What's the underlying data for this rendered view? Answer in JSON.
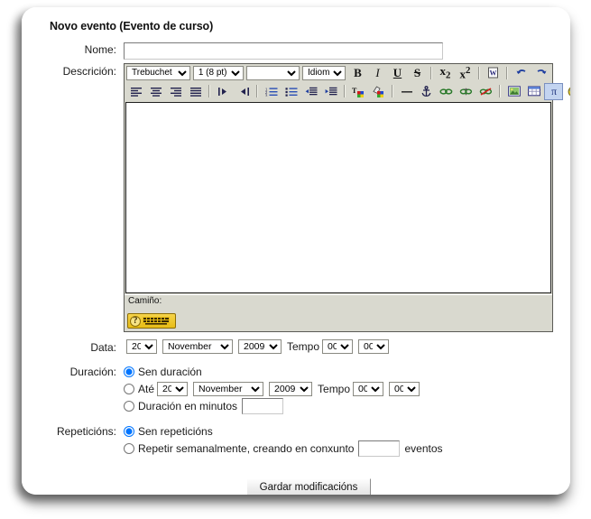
{
  "form": {
    "title": "Novo evento (Evento de curso)",
    "save_label": "Gardar modificacións"
  },
  "fields": {
    "name_label": "Nome:",
    "name_value": "",
    "description_label": "Descrición:",
    "date_label": "Data:",
    "duration_label": "Duración:",
    "repeats_label": "Repeticións:"
  },
  "editor": {
    "font_family_value": "Trebuchet",
    "font_size_value": "1 (8 pt)",
    "format_value": "",
    "language_value": "Idioma",
    "path_label": "Camiño:",
    "content": "",
    "spellcheck_label": "",
    "toolbar_row1": [
      {
        "name": "font-family-select",
        "type": "select",
        "value": "Trebuchet"
      },
      {
        "name": "font-size-select",
        "type": "select",
        "value": "1 (8 pt)"
      },
      {
        "name": "paragraph-format-select",
        "type": "select",
        "value": ""
      },
      {
        "name": "language-select",
        "type": "select",
        "value": "Idioma"
      },
      {
        "name": "bold-icon",
        "type": "button",
        "glyph": "B"
      },
      {
        "name": "italic-icon",
        "type": "button",
        "glyph": "I"
      },
      {
        "name": "underline-icon",
        "type": "button",
        "glyph": "U"
      },
      {
        "name": "strikethrough-icon",
        "type": "button",
        "glyph": "S"
      },
      {
        "name": "subscript-icon",
        "type": "button",
        "glyph": "x2"
      },
      {
        "name": "superscript-icon",
        "type": "button",
        "glyph": "x2"
      },
      {
        "name": "cleanup-word-html-icon",
        "type": "button",
        "glyph": "W"
      },
      {
        "name": "undo-icon",
        "type": "button",
        "glyph": "undo"
      },
      {
        "name": "redo-icon",
        "type": "button",
        "glyph": "redo"
      }
    ],
    "toolbar_row2": [
      {
        "name": "align-left-icon",
        "type": "button"
      },
      {
        "name": "align-center-icon",
        "type": "button"
      },
      {
        "name": "align-right-icon",
        "type": "button"
      },
      {
        "name": "align-justify-icon",
        "type": "button"
      },
      {
        "name": "text-direction-ltr-icon",
        "type": "button"
      },
      {
        "name": "text-direction-rtl-icon",
        "type": "button"
      },
      {
        "name": "ordered-list-icon",
        "type": "button"
      },
      {
        "name": "unordered-list-icon",
        "type": "button"
      },
      {
        "name": "outdent-icon",
        "type": "button"
      },
      {
        "name": "indent-icon",
        "type": "button"
      },
      {
        "name": "text-color-icon",
        "type": "button"
      },
      {
        "name": "background-color-icon",
        "type": "button"
      },
      {
        "name": "horizontal-rule-icon",
        "type": "button"
      },
      {
        "name": "anchor-icon",
        "type": "button"
      },
      {
        "name": "insert-link-icon",
        "type": "button"
      },
      {
        "name": "unlink-icon",
        "type": "button"
      },
      {
        "name": "no-break-icon",
        "type": "button"
      },
      {
        "name": "insert-image-icon",
        "type": "button"
      },
      {
        "name": "insert-table-icon",
        "type": "button"
      },
      {
        "name": "insert-math-icon",
        "type": "button"
      },
      {
        "name": "insert-emoticon-icon",
        "type": "button"
      },
      {
        "name": "insert-media-icon",
        "type": "button"
      },
      {
        "name": "html-source-icon",
        "type": "button"
      },
      {
        "name": "fullscreen-icon",
        "type": "button"
      }
    ]
  },
  "date": {
    "day": "20",
    "month": "November",
    "year": "2009",
    "time_label": "Tempo",
    "hour": "00",
    "minute": "00",
    "day_options": [
      "20"
    ],
    "month_options": [
      "November"
    ],
    "year_options": [
      "2009"
    ],
    "hour_options": [
      "00"
    ],
    "minute_options": [
      "00"
    ]
  },
  "duration": {
    "option_none_label": "Sen duración",
    "option_until_label": "Até",
    "option_minutes_label": "Duración en minutos",
    "selected": "none",
    "until_day": "20",
    "until_month": "November",
    "until_year": "2009",
    "until_time_label": "Tempo",
    "until_hour": "00",
    "until_minute": "00",
    "minutes_value": ""
  },
  "repeats": {
    "option_none_label": "Sen repeticións",
    "option_weekly_label": "Repetir semanalmente, creando en conxunto",
    "events_suffix": "eventos",
    "selected": "none",
    "count_value": ""
  },
  "colors": {
    "toolbar_bg": "#d9d9cf",
    "editor_border": "#5a5a55",
    "page_bg": "#ffffff",
    "spell_button": "#e8bd17",
    "icon_blue": "#1f1f4a"
  }
}
